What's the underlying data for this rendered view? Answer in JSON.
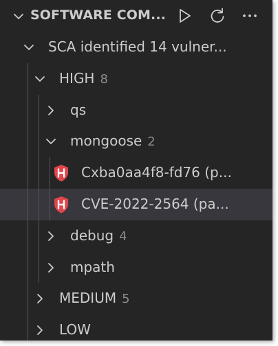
{
  "header": {
    "title": "SOFTWARE COM...",
    "actions": [
      "run-icon",
      "refresh-icon",
      "more-icon"
    ]
  },
  "tree": {
    "root_label": "SCA identified 14 vulner...",
    "high": {
      "label": "HIGH",
      "count": "8"
    },
    "packages": {
      "qs": {
        "label": "qs"
      },
      "mongoose": {
        "label": "mongoose",
        "count": "2",
        "vulns": [
          {
            "label": "Cxba0aa4f8-fd76 (p...",
            "icon": "high-severity-shield-icon"
          },
          {
            "label": "CVE-2022-2564 (pa...",
            "icon": "high-severity-shield-icon"
          }
        ]
      },
      "debug": {
        "label": "debug",
        "count": "4"
      },
      "mpath": {
        "label": "mpath"
      }
    },
    "medium": {
      "label": "MEDIUM",
      "count": "5"
    },
    "low": {
      "label": "LOW"
    }
  },
  "colors": {
    "panel_bg": "#252526",
    "selected_row": "#37373d",
    "text": "#cccccc",
    "count_text": "#8b8b8b",
    "indent_guide": "#585858",
    "severity_high": "#e0474c"
  }
}
